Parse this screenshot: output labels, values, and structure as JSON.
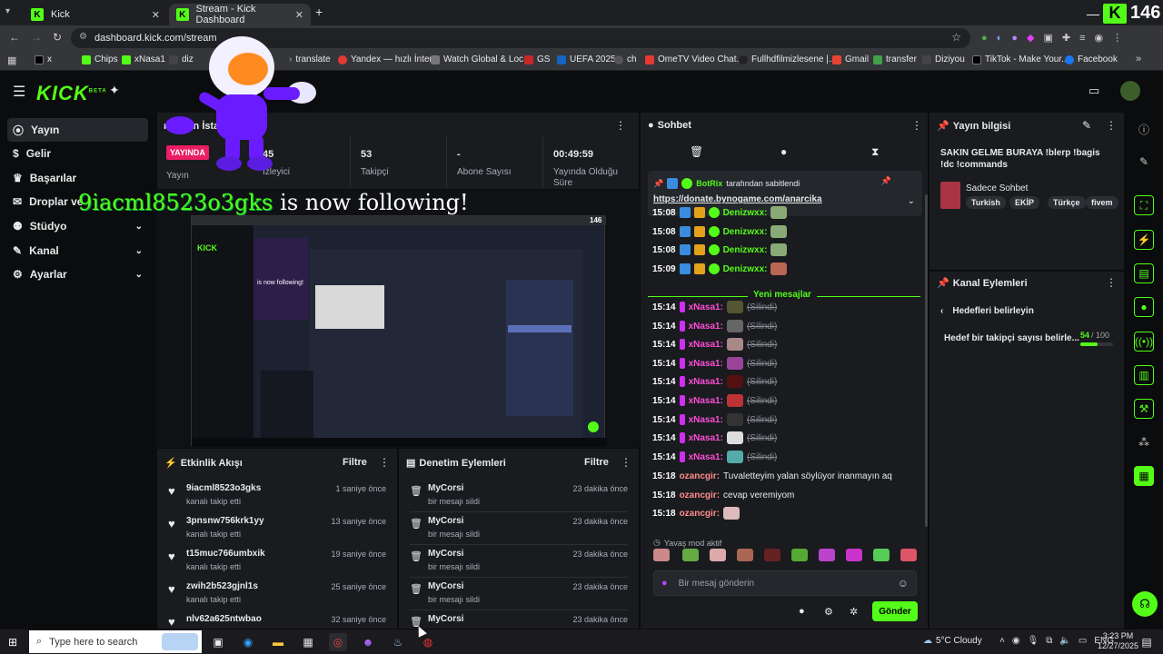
{
  "browser": {
    "tabs": [
      {
        "label": "Kick"
      },
      {
        "label": "Stream - Kick Dashboard"
      }
    ],
    "url": "dashboard.kick.com/stream",
    "counter": "146",
    "bookmarks": [
      "x",
      "Chips",
      "xNasa1",
      "diz",
      "translate",
      "Yandex — hızlı İnter...",
      "Watch Global & Loc...",
      "GS",
      "UEFA 2025",
      "ch",
      "OmeTV Video Chat...",
      "Fullhdfilmizlesene |...",
      "Gmail",
      "transfer",
      "Diziyou",
      "TikTok - Make Your...",
      "Facebook"
    ]
  },
  "kick": {
    "logo": "KICK",
    "beta": "BETA"
  },
  "sidebar": {
    "items": [
      {
        "label": "Yayın"
      },
      {
        "label": "Gelir"
      },
      {
        "label": "Başarılar"
      },
      {
        "label": "Droplar ve"
      },
      {
        "label": "Stüdyo"
      },
      {
        "label": "Kanal"
      },
      {
        "label": "Ayarlar"
      }
    ]
  },
  "stats": {
    "title": "Yayın İstatistikleri",
    "live_badge": "YAYINDA",
    "items": [
      {
        "value": "45",
        "label": "İzleyici"
      },
      {
        "value": "53",
        "label": "Takipçi"
      },
      {
        "value": "-",
        "label": "Abone Sayısı"
      },
      {
        "value": "00:49:59",
        "label": "Yayında Olduğu Süre"
      }
    ],
    "yayin_label": "Yayın"
  },
  "overlay": {
    "follow_user": "9iacml8523o3gks",
    "follow_text": "is now following!",
    "inner_count": "146",
    "inner_follow": "is now following!"
  },
  "activity": {
    "title": "Etkinlik Akışı",
    "filter": "Filtre",
    "items": [
      {
        "user": "9iacml8523o3gks",
        "action": "kanalı takip etti",
        "time": "1 saniye önce"
      },
      {
        "user": "3pnsnw756krk1yy",
        "action": "kanalı takip etti",
        "time": "13 saniye önce"
      },
      {
        "user": "t15muc766umbxik",
        "action": "kanalı takip etti",
        "time": "19 saniye önce"
      },
      {
        "user": "zwih2b523gjnl1s",
        "action": "kanalı takip etti",
        "time": "25 saniye önce"
      },
      {
        "user": "nlv62a625ntwbao",
        "action": "",
        "time": "32 saniye önce"
      }
    ]
  },
  "moderation": {
    "title": "Denetim Eylemleri",
    "filter": "Filtre",
    "items": [
      {
        "user": "MyCorsi",
        "action": "bir mesajı sildi",
        "time": "23 dakika önce"
      },
      {
        "user": "MyCorsi",
        "action": "bir mesajı sildi",
        "time": "23 dakika önce"
      },
      {
        "user": "MyCorsi",
        "action": "bir mesajı sildi",
        "time": "23 dakika önce"
      },
      {
        "user": "MyCorsi",
        "action": "bir mesajı sildi",
        "time": "23 dakika önce"
      },
      {
        "user": "MyCorsi",
        "action": "",
        "time": "23 dakika önce"
      }
    ]
  },
  "chat": {
    "title": "Sohbet",
    "pinned_by": "BotRix",
    "pinned_suffix": "tarafından sabitlendi",
    "pinned_link": "https://donate.bynogame.com/anarcika",
    "new_messages": "Yeni mesajlar",
    "messages": [
      {
        "time": "15:08",
        "user": "Denizwxx:",
        "text": "",
        "color": "#53fc18"
      },
      {
        "time": "15:08",
        "user": "Denizwxx:",
        "text": "",
        "color": "#53fc18"
      },
      {
        "time": "15:08",
        "user": "Denizwxx:",
        "text": "",
        "color": "#53fc18"
      },
      {
        "time": "15:09",
        "user": "Denizwxx:",
        "text": "",
        "color": "#53fc18"
      },
      {
        "time": "15:14",
        "user": "xNasa1:",
        "text": "(Silindi)",
        "color": "#ff4fd8"
      },
      {
        "time": "15:14",
        "user": "xNasa1:",
        "text": "(Silindi)",
        "color": "#ff4fd8"
      },
      {
        "time": "15:14",
        "user": "xNasa1:",
        "text": "(Silindi)",
        "color": "#ff4fd8"
      },
      {
        "time": "15:14",
        "user": "xNasa1:",
        "text": "(Silindi)",
        "color": "#ff4fd8"
      },
      {
        "time": "15:14",
        "user": "xNasa1:",
        "text": "(Silindi)",
        "color": "#ff4fd8"
      },
      {
        "time": "15:14",
        "user": "xNasa1:",
        "text": "(Silindi)",
        "color": "#ff4fd8"
      },
      {
        "time": "15:14",
        "user": "xNasa1:",
        "text": "(Silindi)",
        "color": "#ff4fd8"
      },
      {
        "time": "15:14",
        "user": "xNasa1:",
        "text": "(Silindi)",
        "color": "#ff4fd8"
      },
      {
        "time": "15:14",
        "user": "xNasa1:",
        "text": "(Silindi)",
        "color": "#ff4fd8"
      },
      {
        "time": "15:18",
        "user": "ozancgir:",
        "text": "Tuvaletteyim yalan söylüyor inanmayın aq",
        "color": "#ff8c8c"
      },
      {
        "time": "15:18",
        "user": "ozancgir:",
        "text": "cevap veremiyom",
        "color": "#ff8c8c"
      },
      {
        "time": "15:18",
        "user": "ozancgir:",
        "text": "",
        "color": "#ff8c8c"
      }
    ],
    "slow_mode": "Yavaş mod aktif",
    "input_placeholder": "Bir mesaj gönderin",
    "send_label": "Gönder"
  },
  "stream_info": {
    "title": "Yayın bilgisi",
    "stream_title": "SAKIN GELME BURAYA !blerp !bagis !dc !commands",
    "category": "Sadece Sohbet",
    "tags": [
      "Turkish",
      "EKİP",
      "Türkçe",
      "fivem"
    ]
  },
  "channel_actions": {
    "title": "Kanal Eylemleri",
    "back_label": "Hedefleri belirleyin",
    "goal_label": "Hedef bir takipçi sayısı belirle...",
    "goal_current": "54",
    "goal_total": "/ 100",
    "goal_fraction": 0.54
  },
  "taskbar": {
    "search_placeholder": "Type here to search",
    "weather": "5°C  Cloudy",
    "lang": "ENG",
    "time": "3:23 PM",
    "date": "12/27/2025"
  }
}
